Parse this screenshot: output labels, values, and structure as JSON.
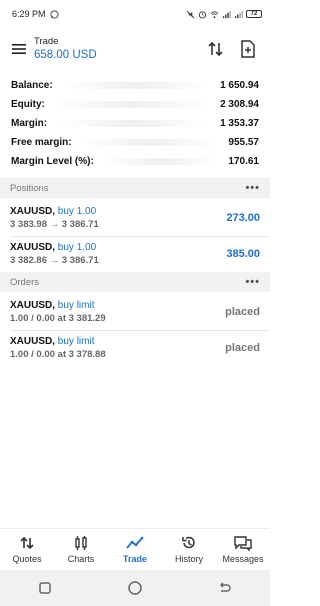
{
  "status_bar": {
    "time": "6:29 PM",
    "battery": "72"
  },
  "header": {
    "title": "Trade",
    "balance": "658.00 USD"
  },
  "summary": [
    {
      "label": "Balance:",
      "value": "1 650.94"
    },
    {
      "label": "Equity:",
      "value": "2 308.94"
    },
    {
      "label": "Margin:",
      "value": "1 353.37"
    },
    {
      "label": "Free margin:",
      "value": "955.57"
    },
    {
      "label": "Margin Level (%):",
      "value": "170.61"
    }
  ],
  "positions": {
    "title": "Positions",
    "items": [
      {
        "symbol": "XAUUSD,",
        "side": "buy 1.00",
        "prices": "3 383.98 → 3 386.71",
        "profit": "273.00"
      },
      {
        "symbol": "XAUUSD,",
        "side": "buy 1.00",
        "prices": "3 382.86 → 3 386.71",
        "profit": "385.00"
      }
    ]
  },
  "orders": {
    "title": "Orders",
    "items": [
      {
        "symbol": "XAUUSD,",
        "side": "buy limit",
        "detail": "1.00 / 0.00 at 3 381.29",
        "state": "placed"
      },
      {
        "symbol": "XAUUSD,",
        "side": "buy limit",
        "detail": "1.00 / 0.00 at 3 378.88",
        "state": "placed"
      }
    ]
  },
  "bottom_nav": [
    {
      "label": "Quotes",
      "icon": "quotes-icon",
      "active": false
    },
    {
      "label": "Charts",
      "icon": "charts-icon",
      "active": false
    },
    {
      "label": "Trade",
      "icon": "trade-icon",
      "active": true
    },
    {
      "label": "History",
      "icon": "history-icon",
      "active": false
    },
    {
      "label": "Messages",
      "icon": "messages-icon",
      "active": false
    }
  ],
  "colors": {
    "accent": "#1c6fc9",
    "section_bg": "#f2f2f2"
  }
}
